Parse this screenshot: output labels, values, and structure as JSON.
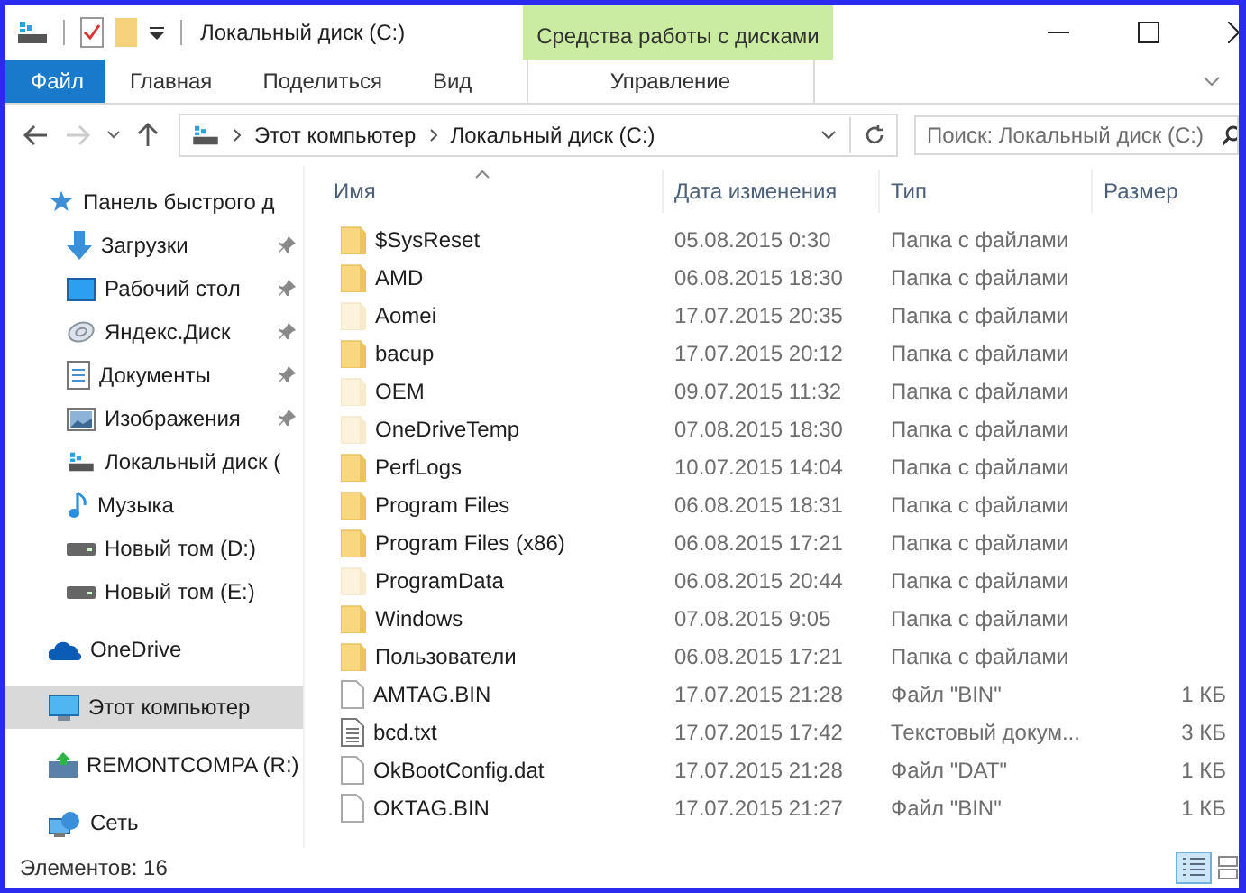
{
  "window": {
    "title": "Локальный диск (C:)",
    "context_tab": "Средства работы с дисками"
  },
  "ribbon_tabs": [
    {
      "label": "Файл",
      "kind": "file",
      "selected": false
    },
    {
      "label": "Главная",
      "kind": "tab",
      "selected": false
    },
    {
      "label": "Поделиться",
      "kind": "tab",
      "selected": false
    },
    {
      "label": "Вид",
      "kind": "tab",
      "selected": false
    },
    {
      "label": "Управление",
      "kind": "context",
      "selected": false
    }
  ],
  "address": {
    "path": [
      {
        "label": "Этот компьютер"
      },
      {
        "label": "Локальный диск (C:)"
      }
    ]
  },
  "search": {
    "placeholder": "Поиск: Локальный диск (C:)"
  },
  "sidebar": {
    "items": [
      {
        "label": "Панель быстрого д",
        "kind": "star",
        "selected": false,
        "children": [
          {
            "label": "Загрузки",
            "kind": "download",
            "pinned": true,
            "selected": false
          },
          {
            "label": "Рабочий стол",
            "kind": "desktop",
            "pinned": true,
            "selected": false
          },
          {
            "label": "Яндекс.Диск",
            "kind": "disk",
            "pinned": true,
            "selected": false
          },
          {
            "label": "Документы",
            "kind": "document",
            "pinned": true,
            "selected": false
          },
          {
            "label": "Изображения",
            "kind": "image",
            "pinned": true,
            "selected": false
          },
          {
            "label": "Локальный диск (",
            "kind": "system",
            "pinned": false,
            "selected": false
          },
          {
            "label": "Музыка",
            "kind": "music",
            "pinned": false,
            "selected": false
          },
          {
            "label": "Новый том (D:)",
            "kind": "drive",
            "pinned": false,
            "selected": false
          },
          {
            "label": "Новый том (E:)",
            "kind": "drive",
            "pinned": false,
            "selected": false
          }
        ]
      },
      {
        "label": "OneDrive",
        "kind": "onedrive",
        "selected": false
      },
      {
        "label": "Этот компьютер",
        "kind": "computer",
        "selected": true
      },
      {
        "label": "REMONTCOMPA (R:)",
        "kind": "usb",
        "selected": false
      },
      {
        "label": "Сеть",
        "kind": "network",
        "selected": false
      }
    ]
  },
  "table": {
    "columns": [
      "Имя",
      "Дата изменения",
      "Тип",
      "Размер"
    ],
    "rows": [
      {
        "name": "$SysReset",
        "date": "05.08.2015 0:30",
        "type": "Папка с файлами",
        "kind": "folder",
        "hidden": false
      },
      {
        "name": "AMD",
        "date": "06.08.2015 18:30",
        "type": "Папка с файлами",
        "kind": "folder",
        "hidden": false
      },
      {
        "name": "Aomei",
        "date": "17.07.2015 20:35",
        "type": "Папка с файлами",
        "kind": "folder",
        "hidden": true
      },
      {
        "name": "bacup",
        "date": "17.07.2015 20:12",
        "type": "Папка с файлами",
        "kind": "folder",
        "hidden": false
      },
      {
        "name": "OEM",
        "date": "09.07.2015 11:32",
        "type": "Папка с файлами",
        "kind": "folder",
        "hidden": true
      },
      {
        "name": "OneDriveTemp",
        "date": "07.08.2015 18:30",
        "type": "Папка с файлами",
        "kind": "folder",
        "hidden": true
      },
      {
        "name": "PerfLogs",
        "date": "10.07.2015 14:04",
        "type": "Папка с файлами",
        "kind": "folder",
        "hidden": false
      },
      {
        "name": "Program Files",
        "date": "06.08.2015 18:31",
        "type": "Папка с файлами",
        "kind": "folder",
        "hidden": false
      },
      {
        "name": "Program Files (x86)",
        "date": "06.08.2015 17:21",
        "type": "Папка с файлами",
        "kind": "folder",
        "hidden": false
      },
      {
        "name": "ProgramData",
        "date": "06.08.2015 20:44",
        "type": "Папка с файлами",
        "kind": "folder",
        "hidden": true
      },
      {
        "name": "Windows",
        "date": "07.08.2015 9:05",
        "type": "Папка с файлами",
        "kind": "folder",
        "hidden": false
      },
      {
        "name": "Пользователи",
        "date": "06.08.2015 17:21",
        "type": "Папка с файлами",
        "kind": "folder",
        "hidden": false
      },
      {
        "name": "AMTAG.BIN",
        "date": "17.07.2015 21:28",
        "type": "Файл \"BIN\"",
        "size": "1 КБ",
        "kind": "file",
        "hidden": false
      },
      {
        "name": "bcd.txt",
        "date": "17.07.2015 17:42",
        "type": "Текстовый докум...",
        "size": "3 КБ",
        "kind": "text",
        "hidden": false
      },
      {
        "name": "OkBootConfig.dat",
        "date": "17.07.2015 21:28",
        "type": "Файл \"DAT\"",
        "size": "1 КБ",
        "kind": "file",
        "hidden": false
      },
      {
        "name": "OKTAG.BIN",
        "date": "17.07.2015 21:27",
        "type": "Файл \"BIN\"",
        "size": "1 КБ",
        "kind": "file",
        "hidden": false
      }
    ]
  },
  "status_bar": {
    "count": "Элементов: 16"
  }
}
